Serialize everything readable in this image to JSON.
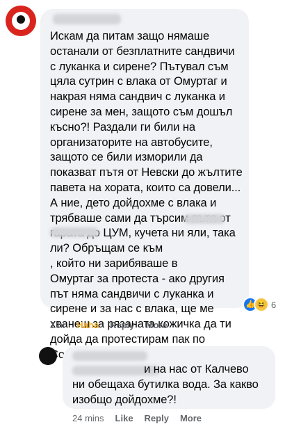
{
  "comment1": {
    "text": "Искам да питам защо нямаше\nостанали от безплатните сандвичи\nс луканка и сирене? Пътувал съм\nцяла сутрин с влака от Омуртаг и\nнакрая няма сандвич с луканка и\nсирене за мен, защото съм дошъл\nкъсно?! Раздали ги били на\nорганизаторите на автобусите,\nзащото се били изморили да\nпоказват пътя от Невски до жълтите\nпавета на хората, които са довели...\nА ние, дето дойдохме с влака и\nтрябваше сами да търсим пътя от\nгарата до ЦУМ, кучета ни яли, така\nли? Обръщам се към\n, който ни зарибяваше в\nОмуртаг за протеста - ако другия\nпът няма сандвичи с луканка и\nсирене и за нас с влака, ще ме\nхванеш за рязаната кожичка да ти\nдойда да протестирам пак по\nСофията!",
    "reaction_count": "6",
    "time": "1 hr",
    "haha_label": "Haha",
    "reply_label": "Reply",
    "more_label": "More"
  },
  "comment2": {
    "text": "                       и на нас от Калчево\nни обещаха бутилка вода. За какво\nизобщо дойдохме?!",
    "time": "24 mins",
    "like_label": "Like",
    "reply_label": "Reply",
    "more_label": "More"
  },
  "icons": {
    "reaction_like": "thumbs-up-icon",
    "reaction_haha": "laughing-face-icon"
  },
  "colors": {
    "bubble": "#f0f2f5",
    "meta": "#65676b",
    "haha": "#f7b125",
    "like_blue": "#1877f2"
  }
}
